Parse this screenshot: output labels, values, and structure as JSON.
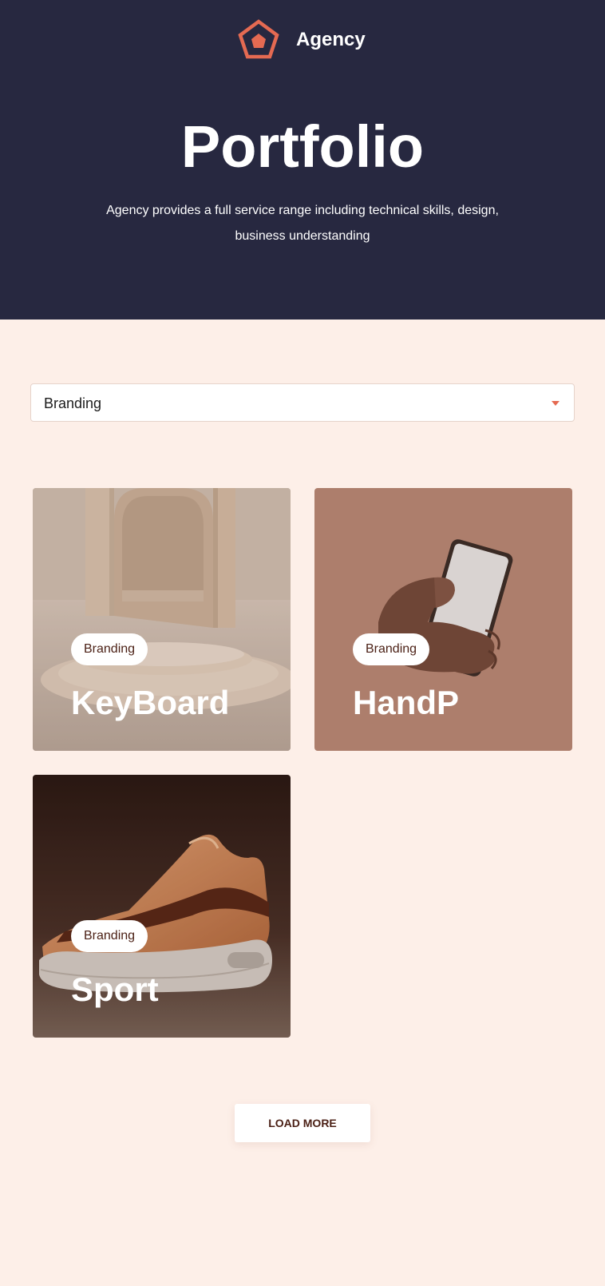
{
  "brand": {
    "name": "Agency",
    "logo_icon": "pentagon-logo-icon",
    "accent": "#e56a52"
  },
  "hero": {
    "title": "Portfolio",
    "description": "Agency provides a full service range including technical skills, design, business understanding",
    "background": "#272840"
  },
  "filter": {
    "selected": "Branding",
    "icon": "caret-down-icon"
  },
  "projects": [
    {
      "category": "Branding",
      "title": "KeyBoard",
      "image": "archway-podium-image"
    },
    {
      "category": "Branding",
      "title": "HandP",
      "image": "hand-holding-phone-image"
    },
    {
      "category": "Branding",
      "title": "Sport",
      "image": "sneaker-image"
    }
  ],
  "load_more": {
    "label": "LOAD MORE"
  },
  "colors": {
    "page_background": "#fdefe8",
    "text_dark": "#4a1f14"
  }
}
